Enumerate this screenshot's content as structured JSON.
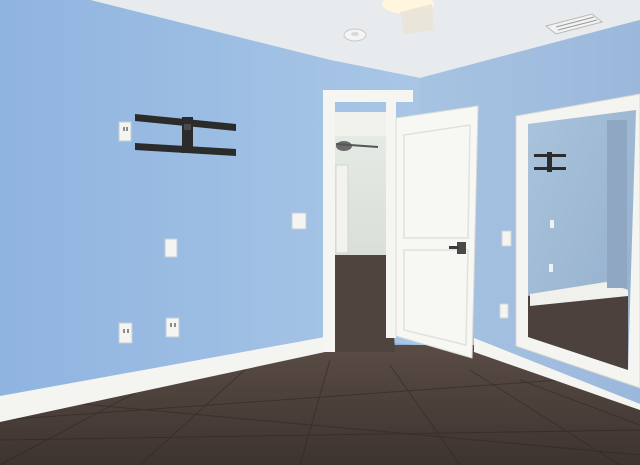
{
  "scene": {
    "description_free": true,
    "colors": {
      "wall_left": "#9dbde3",
      "wall_right": "#a6c2e2",
      "ceiling": "#e9ecef",
      "floor": "#4a3f3a",
      "trim": "#f3f3f0",
      "door": "#f6f6f3",
      "mirror_glass": "#9fb9d2",
      "mount_metal": "#2b2b2b"
    },
    "objects": {
      "tv_mount": "tv-wall-mount",
      "door": "open-interior-door",
      "mirror": "mirror-closet-door",
      "ceiling_light": "ceiling-light",
      "vent": "ceiling-vent",
      "smoke_detector": "smoke-detector"
    }
  }
}
